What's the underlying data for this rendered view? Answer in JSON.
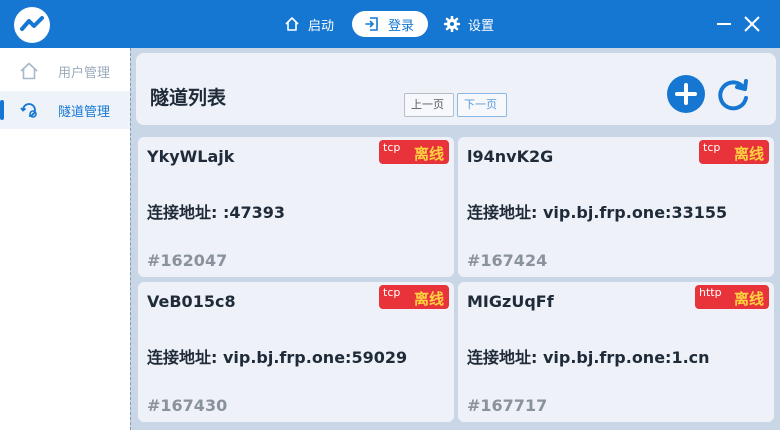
{
  "titlebar": {
    "nav": [
      {
        "label": "启动",
        "icon": "home-icon"
      },
      {
        "label": "登录",
        "icon": "login-icon"
      },
      {
        "label": "设置",
        "icon": "gear-icon"
      }
    ],
    "accent_color": "#1677d2"
  },
  "sidebar": {
    "items": [
      {
        "label": "用户管理",
        "icon": "home-icon",
        "active": false
      },
      {
        "label": "隧道管理",
        "icon": "tunnel-gear-icon",
        "active": true
      }
    ]
  },
  "main": {
    "title": "隧道列表",
    "prev_label": "上一页",
    "next_label": "下一页",
    "tunnels": [
      {
        "name": "YkyWLajk",
        "protocol": "tcp",
        "status": "离线",
        "address": "连接地址: :47393",
        "id": "#162047"
      },
      {
        "name": "l94nvK2G",
        "protocol": "tcp",
        "status": "离线",
        "address": "连接地址: vip.bj.frp.one:33155",
        "id": "#167424"
      },
      {
        "name": "VeB015c8",
        "protocol": "tcp",
        "status": "离线",
        "address": "连接地址: vip.bj.frp.one:59029",
        "id": "#167430"
      },
      {
        "name": "MIGzUqFf",
        "protocol": "http",
        "status": "离线",
        "address": "连接地址: vip.bj.frp.one:1.cn",
        "id": "#167717"
      }
    ],
    "badge_color": "#e8333b",
    "status_color": "#ffd23f"
  }
}
